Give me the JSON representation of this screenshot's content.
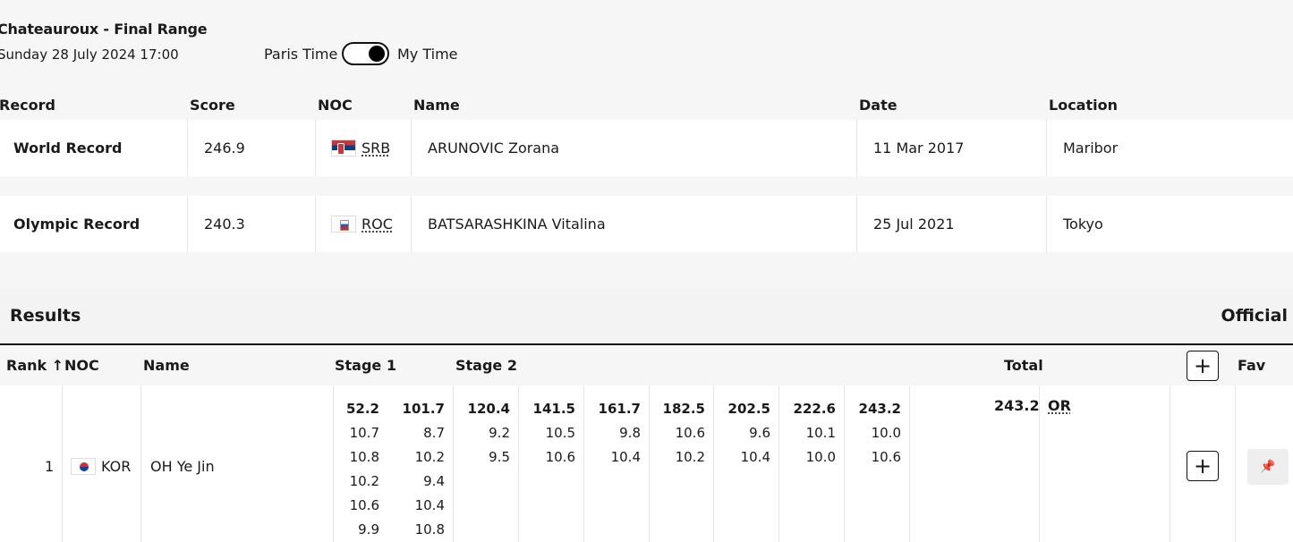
{
  "event": {
    "title": "Chateauroux - Final Range",
    "datetime": "Sunday 28 July 2024 17:00",
    "toggle_left": "Paris Time",
    "toggle_right": "My Time"
  },
  "records": {
    "headers": [
      "Record",
      "Score",
      "NOC",
      "Name",
      "Date",
      "Location"
    ],
    "rows": [
      {
        "record": "World Record",
        "score": "246.9",
        "noc": "SRB",
        "name": "ARUNOVIC Zorana",
        "date": "11 Mar 2017",
        "location": "Maribor"
      },
      {
        "record": "Olympic Record",
        "score": "240.3",
        "noc": "ROC",
        "name": "BATSARASHKINA Vitalina",
        "date": "25 Jul 2021",
        "location": "Tokyo"
      }
    ]
  },
  "results": {
    "title": "Results",
    "status": "Official",
    "headers": {
      "rank": "Rank",
      "rank_sort_icon": "↑",
      "noc": "NOC",
      "name": "Name",
      "stage1": "Stage 1",
      "stage2": "Stage 2",
      "total": "Total",
      "add_icon": "+",
      "fav": "Fav"
    },
    "rows": [
      {
        "rank": "1",
        "noc": "KOR",
        "name": "OH Ye Jin",
        "stage_columns": [
          {
            "cumulative": "52.2",
            "shots": [
              "10.7",
              "10.8",
              "10.2",
              "10.6",
              "9.9"
            ]
          },
          {
            "cumulative": "101.7",
            "shots": [
              "8.7",
              "10.2",
              "9.4",
              "10.4",
              "10.8"
            ]
          },
          {
            "cumulative": "120.4",
            "shots": [
              "9.2",
              "9.5"
            ]
          },
          {
            "cumulative": "141.5",
            "shots": [
              "10.5",
              "10.6"
            ]
          },
          {
            "cumulative": "161.7",
            "shots": [
              "9.8",
              "10.4"
            ]
          },
          {
            "cumulative": "182.5",
            "shots": [
              "10.6",
              "10.2"
            ]
          },
          {
            "cumulative": "202.5",
            "shots": [
              "9.6",
              "10.4"
            ]
          },
          {
            "cumulative": "222.6",
            "shots": [
              "10.1",
              "10.0"
            ]
          },
          {
            "cumulative": "243.2",
            "shots": [
              "10.0",
              "10.6"
            ]
          }
        ],
        "total": "243.2",
        "record_badge": "OR",
        "add_icon": "+",
        "pin_icon": "📌"
      }
    ]
  },
  "icons": {
    "sort": "arrow-up-icon",
    "add": "plus-icon",
    "pin": "pin-icon"
  }
}
